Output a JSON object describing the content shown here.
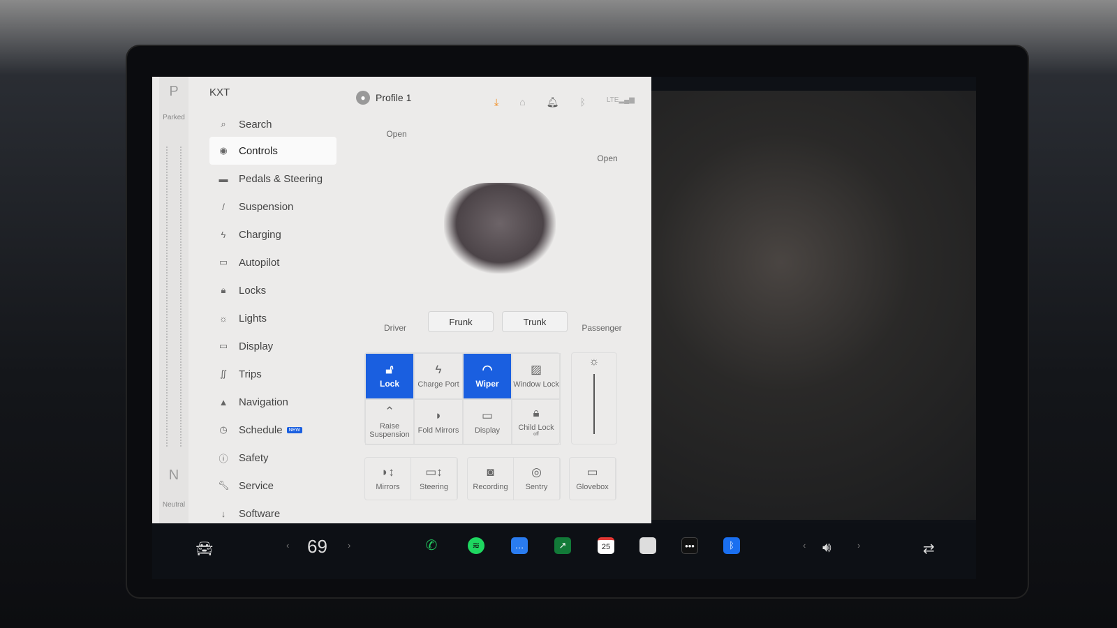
{
  "gear": {
    "top": "P",
    "top_label": "Parked",
    "bottom": "N",
    "bottom_label": "Neutral"
  },
  "vehicle_name": "KXT",
  "profile": "Profile 1",
  "menu": [
    {
      "icon": "search-icon",
      "glyph": "⌕",
      "label": "Search"
    },
    {
      "icon": "toggle-icon",
      "glyph": "◉",
      "label": "Controls"
    },
    {
      "icon": "car-icon",
      "glyph": "▬",
      "label": "Pedals & Steering"
    },
    {
      "icon": "wrench-icon",
      "glyph": "/",
      "label": "Suspension"
    },
    {
      "icon": "bolt-icon",
      "glyph": "ϟ",
      "label": "Charging"
    },
    {
      "icon": "steering-icon",
      "glyph": "▭",
      "label": "Autopilot"
    },
    {
      "icon": "lock-icon",
      "glyph": "🔒︎",
      "label": "Locks"
    },
    {
      "icon": "sun-icon",
      "glyph": "☼",
      "label": "Lights"
    },
    {
      "icon": "display-icon",
      "glyph": "▭",
      "label": "Display"
    },
    {
      "icon": "trips-icon",
      "glyph": "∬",
      "label": "Trips"
    },
    {
      "icon": "navigation-icon",
      "glyph": "▲",
      "label": "Navigation"
    },
    {
      "icon": "clock-icon",
      "glyph": "◷",
      "label": "Schedule",
      "badge": "NEW"
    },
    {
      "icon": "safety-icon",
      "glyph": "ⓘ",
      "label": "Safety"
    },
    {
      "icon": "service-icon",
      "glyph": "🔧︎",
      "label": "Service"
    },
    {
      "icon": "download-icon",
      "glyph": "↓",
      "label": "Software"
    }
  ],
  "car": {
    "frunk_open": "Open",
    "trunk_open": "Open",
    "driver": "Driver",
    "passenger": "Passenger",
    "frunk": "Frunk",
    "trunk": "Trunk"
  },
  "controls": [
    {
      "label": "Lock",
      "icon": "unlock-icon",
      "glyph": "🔓︎",
      "active": true
    },
    {
      "label": "Charge Port",
      "icon": "bolt-icon",
      "glyph": "ϟ"
    },
    {
      "label": "Wiper",
      "icon": "wiper-icon",
      "glyph": "◠",
      "active": true
    },
    {
      "label": "Window Lock",
      "icon": "window-icon",
      "glyph": "▨"
    },
    {
      "label": "Raise Suspension",
      "icon": "suspension-icon",
      "glyph": "⌃"
    },
    {
      "label": "Fold Mirrors",
      "icon": "mirror-icon",
      "glyph": "◗"
    },
    {
      "label": "Display",
      "icon": "display-icon",
      "glyph": "▭"
    },
    {
      "label": "Child Lock",
      "icon": "child-lock-icon",
      "glyph": "🔒︎",
      "sub": "off"
    }
  ],
  "row2": [
    [
      {
        "label": "Mirrors",
        "icon": "mirror-adjust-icon",
        "glyph": "◗↕"
      },
      {
        "label": "Steering",
        "icon": "steering-adjust-icon",
        "glyph": "▭↕"
      }
    ],
    [
      {
        "label": "Recording",
        "icon": "dashcam-icon",
        "glyph": "◙"
      },
      {
        "label": "Sentry",
        "icon": "sentry-icon",
        "glyph": "◎"
      }
    ],
    [
      {
        "label": "Glovebox",
        "icon": "glovebox-icon",
        "glyph": "▭"
      }
    ]
  ],
  "dock": {
    "temperature": "69",
    "calendar_day": "25",
    "colors": {
      "phone": "#22c55e",
      "spotify": "#1ed760",
      "messages": "#2a7cf0",
      "bluetooth": "#1a6ff0",
      "accent": "#1a5fe0"
    }
  }
}
